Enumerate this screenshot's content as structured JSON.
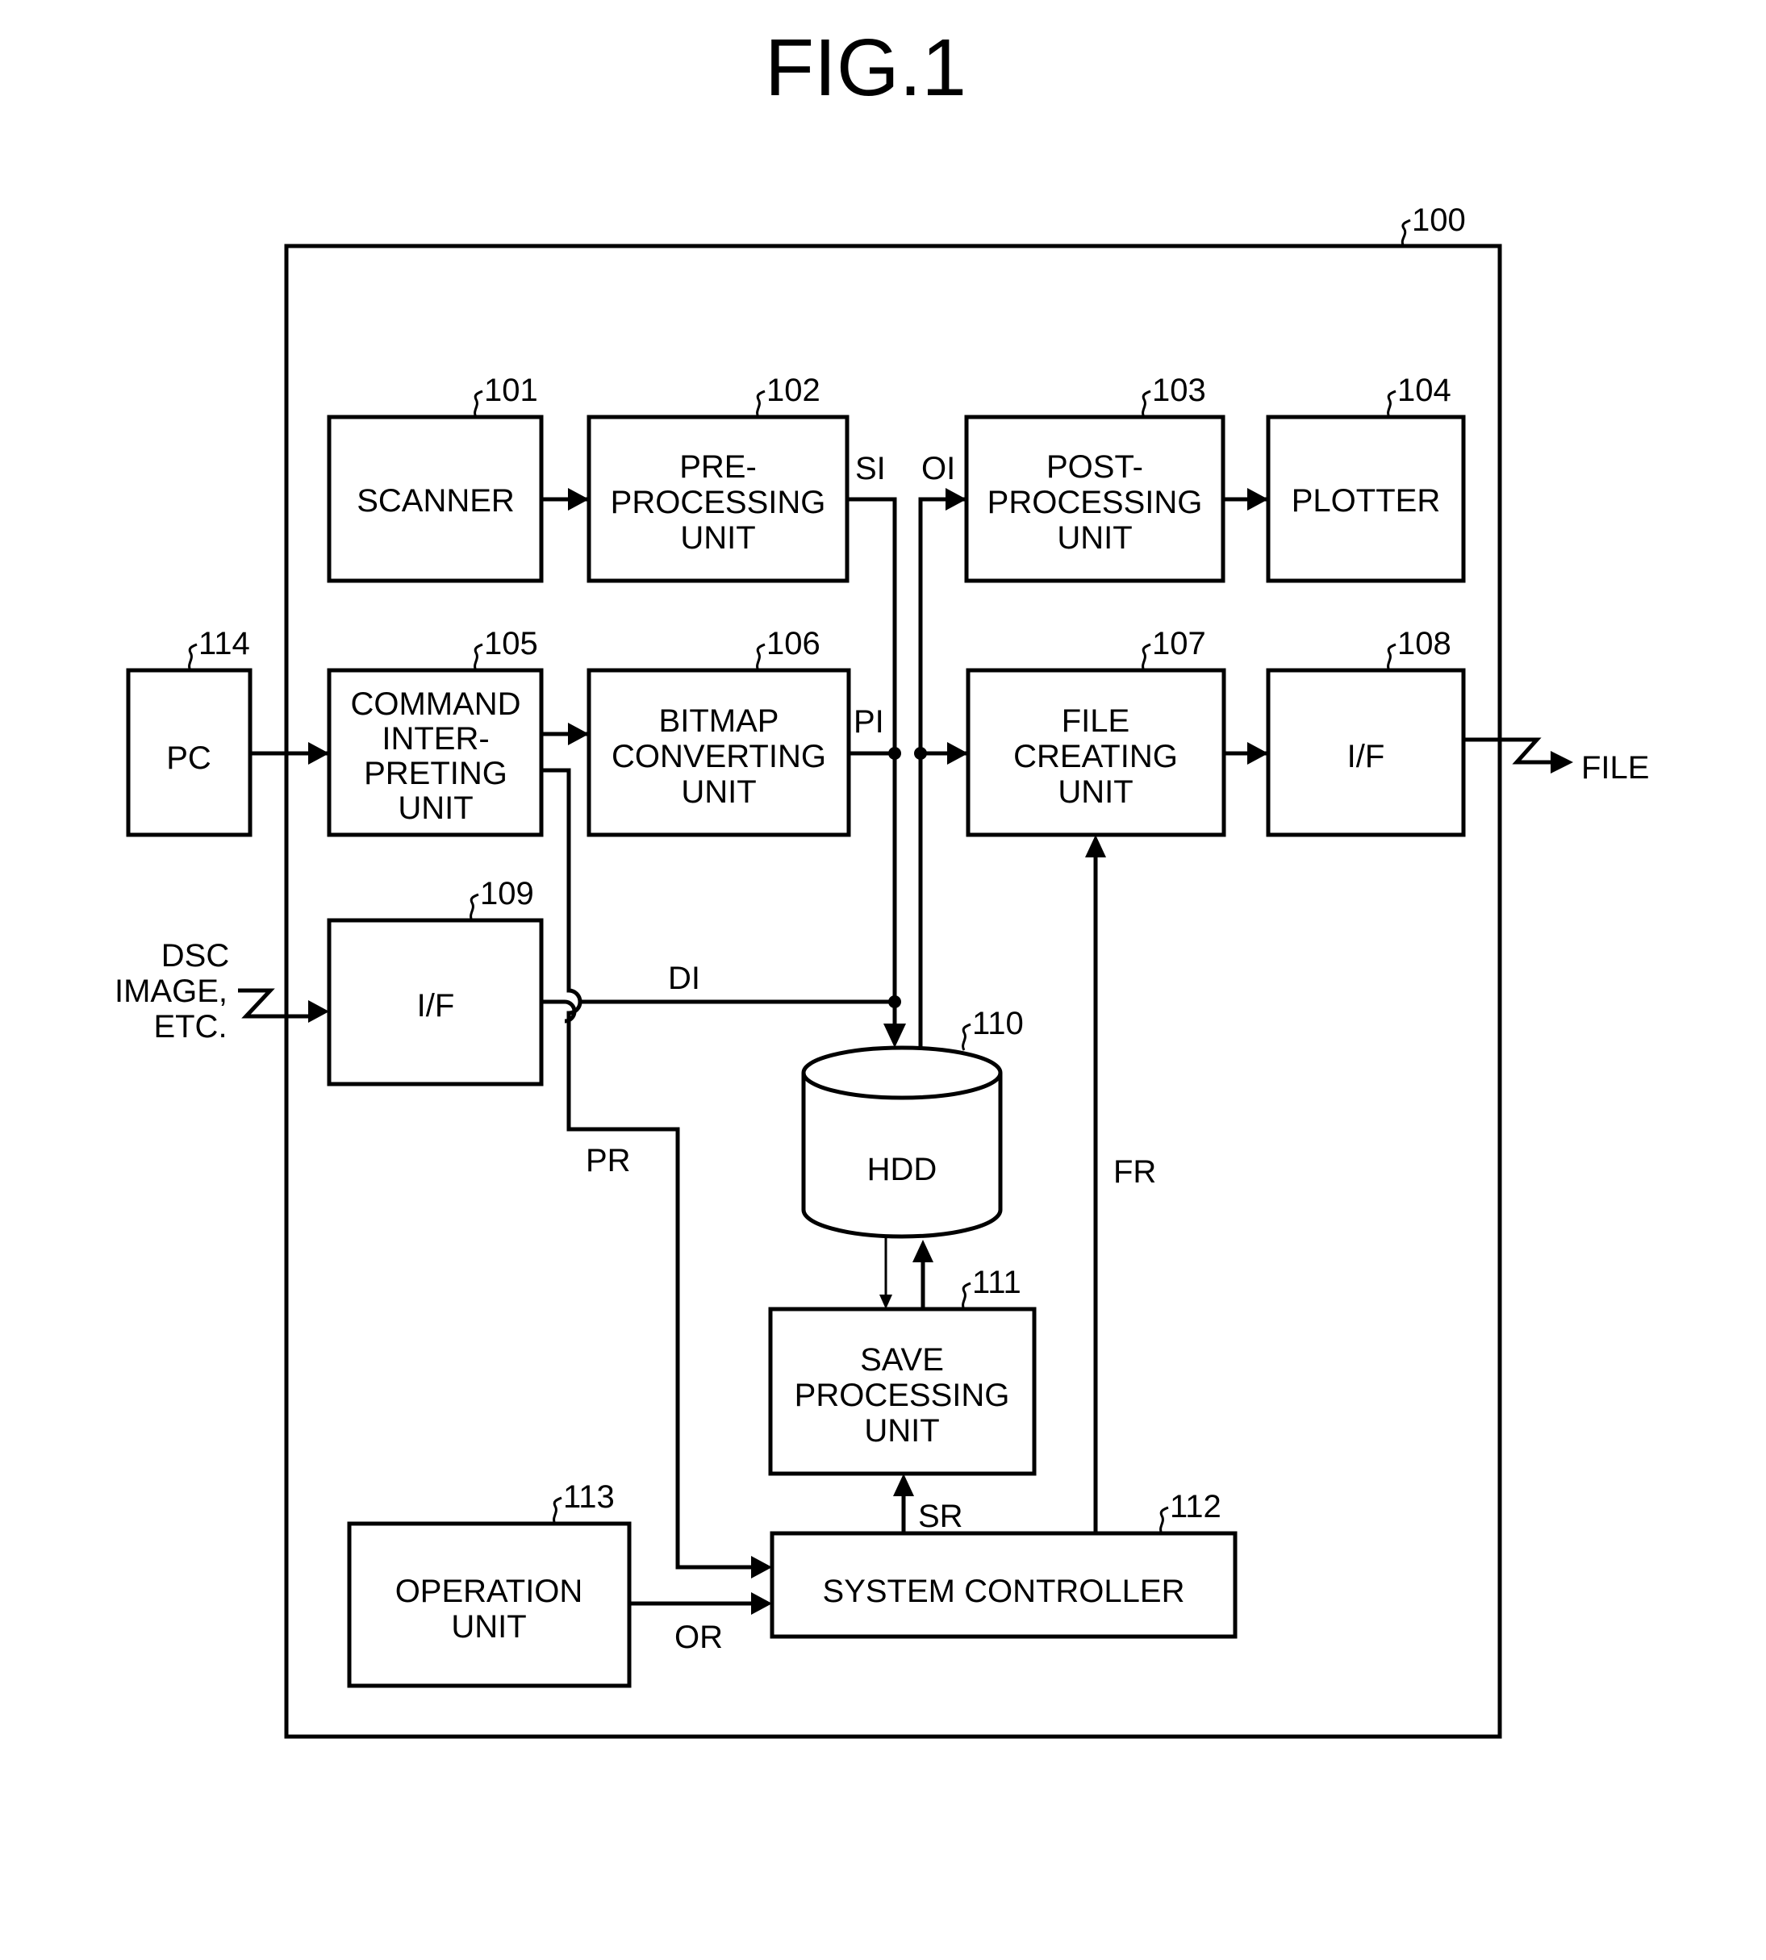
{
  "figure": {
    "title": "FIG.1",
    "system_ref": "100"
  },
  "blocks": {
    "scanner": {
      "ref": "101",
      "lines": [
        "SCANNER"
      ]
    },
    "preprocessing": {
      "ref": "102",
      "lines": [
        "PRE-",
        "PROCESSING",
        "UNIT"
      ]
    },
    "postprocessing": {
      "ref": "103",
      "lines": [
        "POST-",
        "PROCESSING",
        "UNIT"
      ]
    },
    "plotter": {
      "ref": "104",
      "lines": [
        "PLOTTER"
      ]
    },
    "command": {
      "ref": "105",
      "lines": [
        "COMMAND",
        "INTER-",
        "PRETING",
        "UNIT"
      ]
    },
    "bitmap": {
      "ref": "106",
      "lines": [
        "BITMAP",
        "CONVERTING",
        "UNIT"
      ]
    },
    "filecreating": {
      "ref": "107",
      "lines": [
        "FILE",
        "CREATING",
        "UNIT"
      ]
    },
    "if_out": {
      "ref": "108",
      "lines": [
        "I/F"
      ]
    },
    "if_in": {
      "ref": "109",
      "lines": [
        "I/F"
      ]
    },
    "hdd": {
      "ref": "110",
      "lines": [
        "HDD"
      ]
    },
    "save": {
      "ref": "111",
      "lines": [
        "SAVE",
        "PROCESSING",
        "UNIT"
      ]
    },
    "syscontroller": {
      "ref": "112",
      "lines": [
        "SYSTEM CONTROLLER"
      ]
    },
    "operation": {
      "ref": "113",
      "lines": [
        "OPERATION",
        "UNIT"
      ]
    },
    "pc": {
      "ref": "114",
      "lines": [
        "PC"
      ]
    }
  },
  "signals": {
    "si": "SI",
    "oi": "OI",
    "pi": "PI",
    "di": "DI",
    "pr": "PR",
    "fr": "FR",
    "sr": "SR",
    "or": "OR"
  },
  "external": {
    "dsc_lines": [
      "DSC",
      "IMAGE,",
      "ETC."
    ],
    "file_out": "FILE"
  }
}
